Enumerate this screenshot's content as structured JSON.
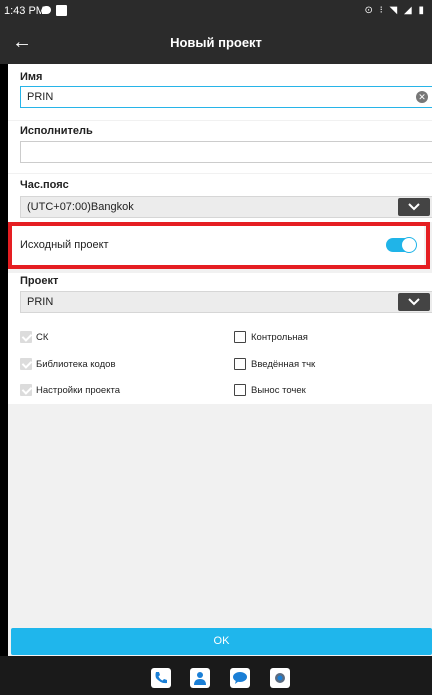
{
  "status_bar": {
    "time": "1:43 PM",
    "right_icons": "⊙ ⁝ ◥ ◢ ▮"
  },
  "app_bar": {
    "title": "Новый проект",
    "back_icon": "←"
  },
  "form": {
    "name": {
      "label": "Имя",
      "value": "PRIN",
      "clear_icon": "✕"
    },
    "executor": {
      "label": "Исполнитель",
      "value": ""
    },
    "timezone": {
      "label": "Час.пояс",
      "value": "(UTC+07:00)Bangkok"
    },
    "source_project": {
      "label": "Исходный проект",
      "enabled": true
    },
    "project": {
      "label": "Проект",
      "value": "PRIN"
    },
    "checkboxes": [
      {
        "label": "СК",
        "checked": true
      },
      {
        "label": "Контрольная",
        "checked": false
      },
      {
        "label": "Библиотека кодов",
        "checked": true
      },
      {
        "label": "Введённая тчк",
        "checked": false
      },
      {
        "label": "Настройки проекта",
        "checked": true
      },
      {
        "label": "Вынос точек",
        "checked": false
      }
    ]
  },
  "ok_button": {
    "label": "OK"
  },
  "nav_apps": [
    "phone-icon",
    "contacts-icon",
    "messages-icon",
    "camera-icon"
  ],
  "colors": {
    "accent": "#1fb6ec",
    "highlight": "#e51e22",
    "dark_bar": "#2b2b2b"
  }
}
